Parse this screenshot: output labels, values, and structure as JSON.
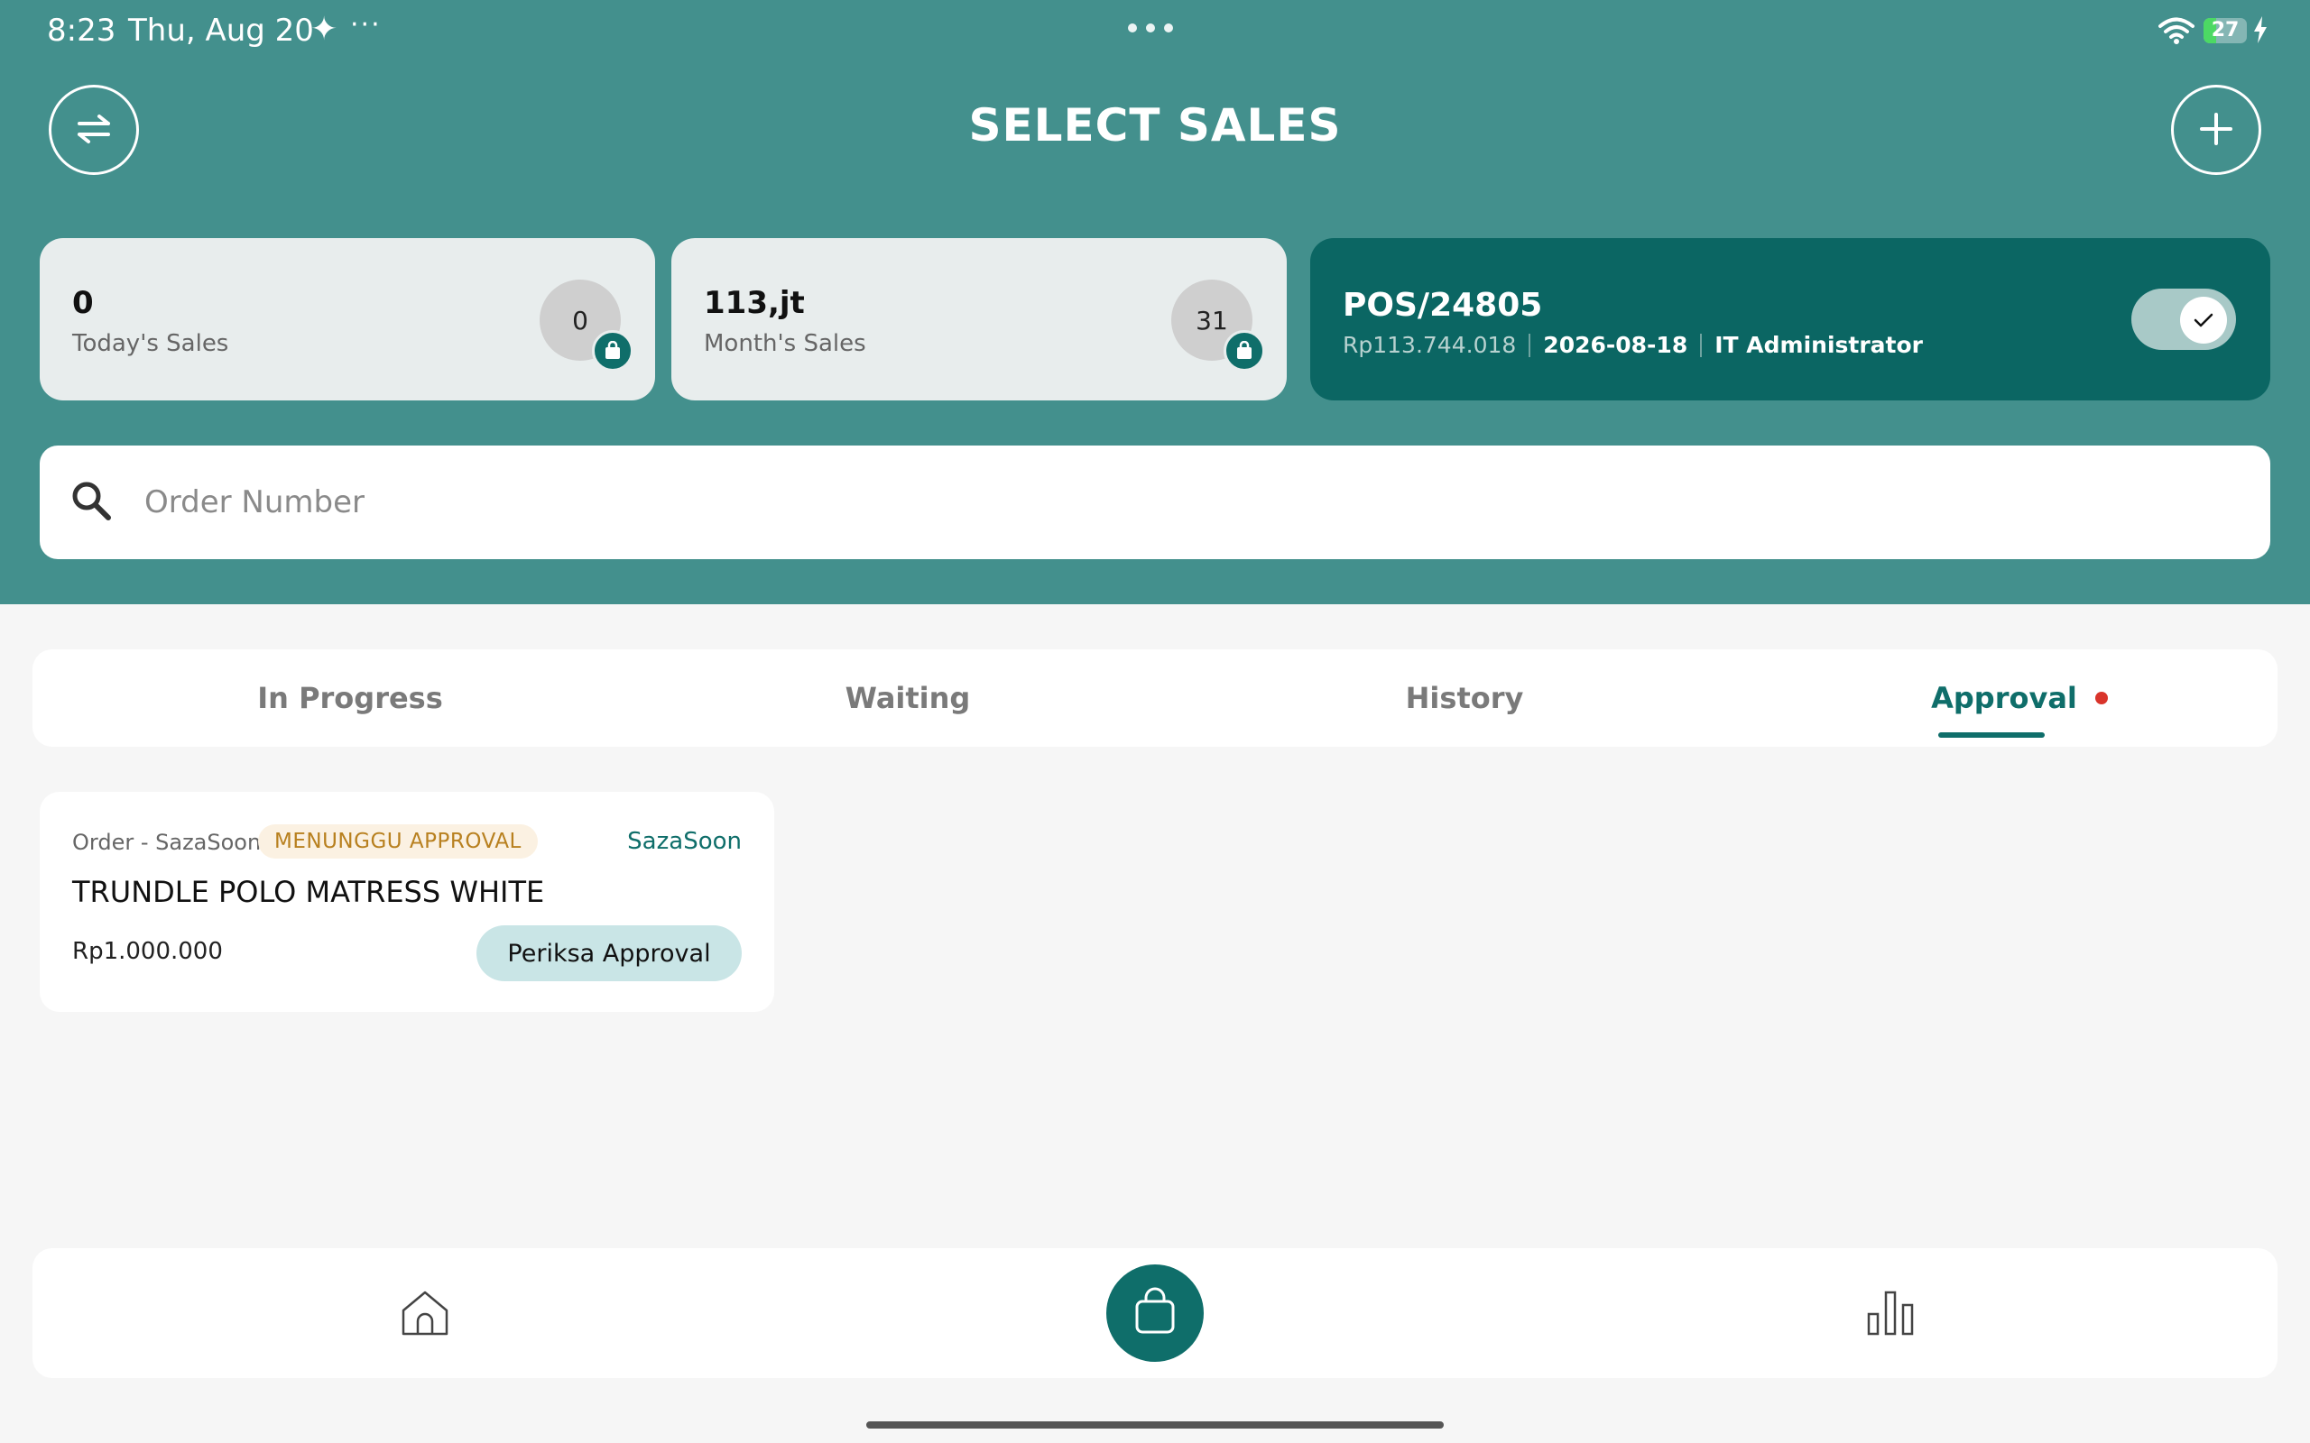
{
  "status_bar": {
    "time": "8:23",
    "date": "Thu, Aug 20",
    "more": "···",
    "battery": "27"
  },
  "header": {
    "title": "SELECT SALES"
  },
  "summary": {
    "today_value": "0",
    "today_label": "Today's Sales",
    "today_count": "0",
    "month_value": "113,jt",
    "month_label": "Month's Sales",
    "month_count": "31"
  },
  "pos": {
    "id": "POS/24805",
    "amount": "Rp113.744.018",
    "date": "2026-08-18",
    "user": "IT Administrator",
    "toggle_on": true
  },
  "search": {
    "placeholder": "Order Number"
  },
  "tabs": [
    {
      "label": "In Progress"
    },
    {
      "label": "Waiting"
    },
    {
      "label": "History"
    },
    {
      "label": "Approval"
    }
  ],
  "orders": [
    {
      "type": "Order - SazaSoon",
      "status": "MENUNGGU APPROVAL",
      "store": "SazaSoon",
      "product": "TRUNDLE POLO MATRESS WHITE",
      "price": "Rp1.000.000",
      "action": "Periksa Approval"
    }
  ],
  "colors": {
    "header_bg": "#43908d",
    "primary": "#0f6e6a",
    "badge_bg": "#fbf1e2",
    "badge_text": "#b8801f",
    "notification_dot": "#d9342b"
  },
  "icons": {
    "swap": "swap-arrows-icon",
    "add": "plus-icon",
    "search": "search-icon",
    "home": "home-icon",
    "bag": "shopping-bag-icon",
    "stats": "bar-chart-icon"
  }
}
